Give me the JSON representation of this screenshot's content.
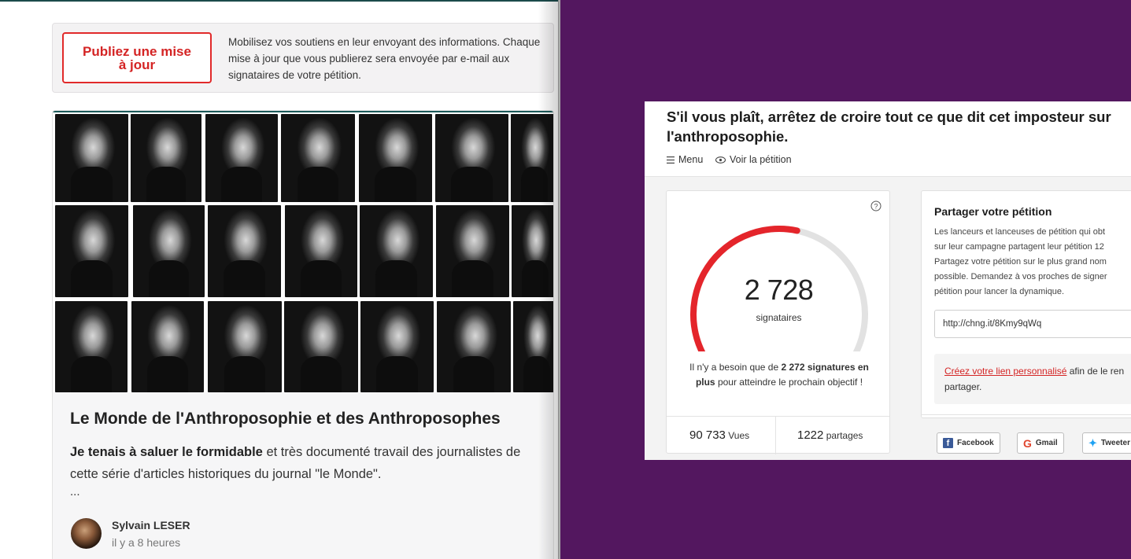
{
  "left": {
    "update_card": {
      "button_label": "Publiez une mise à jour",
      "text": "Mobilisez vos soutiens en leur envoyant des informations. Chaque mise à jour que vous publierez sera envoyée par e-mail aux signataires de votre pétition."
    },
    "post": {
      "title": "Le Monde de l'Anthroposophie et des Anthroposophes",
      "body_bold": "Je tenais à saluer le formidable",
      "body_rest": " et très documenté travail des journalistes de cette série d'articles historiques du journal \"le Monde\".",
      "ellipsis": "...",
      "author_name": "Sylvain LESER",
      "author_time": "il y a 8 heures"
    }
  },
  "petition": {
    "title": "S'il vous plaît, arrêtez de croire tout ce que dit cet imposteur sur l'anthroposophie.",
    "nav_menu": "Menu",
    "nav_view": "Voir la pétition",
    "signatures": "2 728",
    "signatures_label": "signataires",
    "progress_fraction": 0.545,
    "need_prefix": "Il n'y a besoin que de ",
    "need_bold": "2 272 signatures en plus",
    "need_suffix": " pour atteindre le prochain objectif !",
    "views_count": "90 733",
    "views_label": "Vues",
    "shares_count": "1222",
    "shares_label": "partages",
    "colors": {
      "gauge_fill": "#e4252b",
      "gauge_track": "#e2e2e2",
      "background": "#53175f"
    }
  },
  "share": {
    "title": "Partager votre pétition",
    "desc_lines": [
      "Les lanceurs et lanceuses de pétition qui obt",
      "sur leur campagne partagent leur pétition 12",
      "Partagez votre pétition sur le plus grand nom",
      "possible. Demandez à vos proches de signer",
      "pétition pour lancer la dynamique."
    ],
    "url": "http://chng.it/8Kmy9qWq",
    "custom_link": "Créez votre lien personnalisé",
    "custom_rest": " afin de le ren",
    "custom_line2": "partager.",
    "facebook": "Facebook",
    "gmail": "Gmail",
    "tweet": "Tweeter",
    "icons": [
      "facebook-icon",
      "gmail-icon",
      "twitter-icon",
      "help-icon",
      "menu-icon",
      "eye-icon"
    ]
  }
}
